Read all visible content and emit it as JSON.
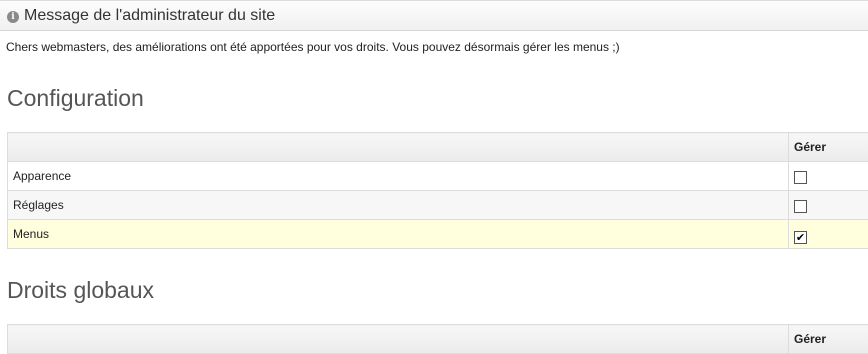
{
  "notice": {
    "title": "Message de l'administrateur du site",
    "icon": "info-icon",
    "message": "Chers webmasters, des améliorations ont été apportées pour vos droits. Vous pouvez désormais gérer les menus  ;)"
  },
  "sections": [
    {
      "heading": "Configuration",
      "column_header": "Gérer",
      "rows": [
        {
          "label": "Apparence",
          "checked": false
        },
        {
          "label": "Réglages",
          "checked": false
        },
        {
          "label": "Menus",
          "checked": true
        }
      ]
    },
    {
      "heading": "Droits globaux",
      "column_header": "Gérer"
    }
  ],
  "colors": {
    "selected_row": "#ffffdd",
    "header_bg": "#ebebeb"
  }
}
